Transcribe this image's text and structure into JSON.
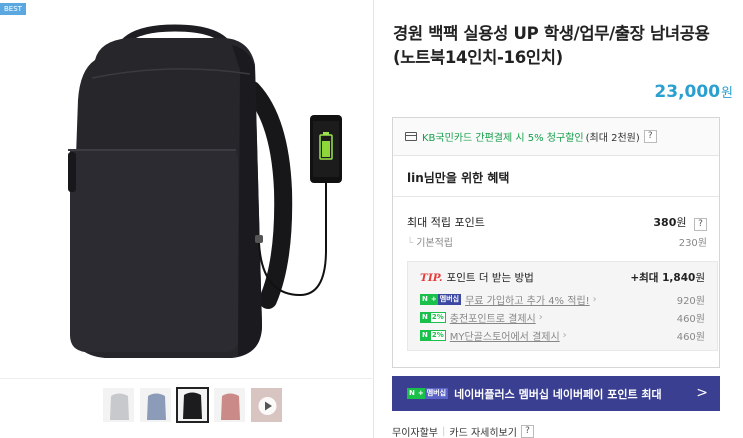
{
  "product": {
    "best_badge": "BEST",
    "title": "경원 백팩 실용성 UP 학생/업무/출장 남녀공용 (노트북14인치-16인치)",
    "price": "23,000",
    "price_unit": "원"
  },
  "thumbnails": [
    {
      "name": "thumb-gray",
      "color": "#c7c9cc"
    },
    {
      "name": "thumb-blue",
      "color": "#8c9cb8"
    },
    {
      "name": "thumb-black",
      "color": "#1c1c1f"
    },
    {
      "name": "thumb-pink",
      "color": "#c98a88"
    },
    {
      "name": "thumb-video",
      "color": "#d8c5c2"
    }
  ],
  "card_benefit": {
    "text": "KB국민카드 간편결제 시 5% 청구할인",
    "sub": "(최대 2천원)",
    "help": "?"
  },
  "for_you": "lin님만을 위한 혜택",
  "points": {
    "max_label": "최대 적립 포인트",
    "max_value": "380",
    "max_unit": "원",
    "help": "?",
    "basic_label": "기본적립",
    "basic_value": "230원"
  },
  "tip": {
    "tip_word": "TIP.",
    "heading": "포인트 더 받는 방법",
    "max_extra": "+최대 1,840",
    "max_extra_unit": "원",
    "items": [
      {
        "badge": "membership",
        "text": "무료 가입하고 추가 4% 적립!",
        "value": "920원"
      },
      {
        "badge": "2%",
        "text": "충전포인트로 결제시",
        "value": "460원"
      },
      {
        "badge": "2%",
        "text": "MY단골스토어에서 결제시",
        "value": "460원"
      }
    ],
    "badge_n": "N",
    "badge_plus": "+",
    "badge_membership": "멤버십"
  },
  "naver_plus_banner": {
    "badge_n": "N",
    "badge_plus": "+",
    "badge_membership": "멤버십",
    "text": "네이버플러스 멤버십 네이버페이 포인트 최대",
    "arrow": ">"
  },
  "bottom": {
    "installment": "무이자할부",
    "card_detail": "카드 자세히보기",
    "help": "?"
  },
  "colors": {
    "price": "#2a9fd0",
    "green": "#15a04a",
    "banner": "#3a3f91",
    "tip_red": "#e53b3b"
  }
}
